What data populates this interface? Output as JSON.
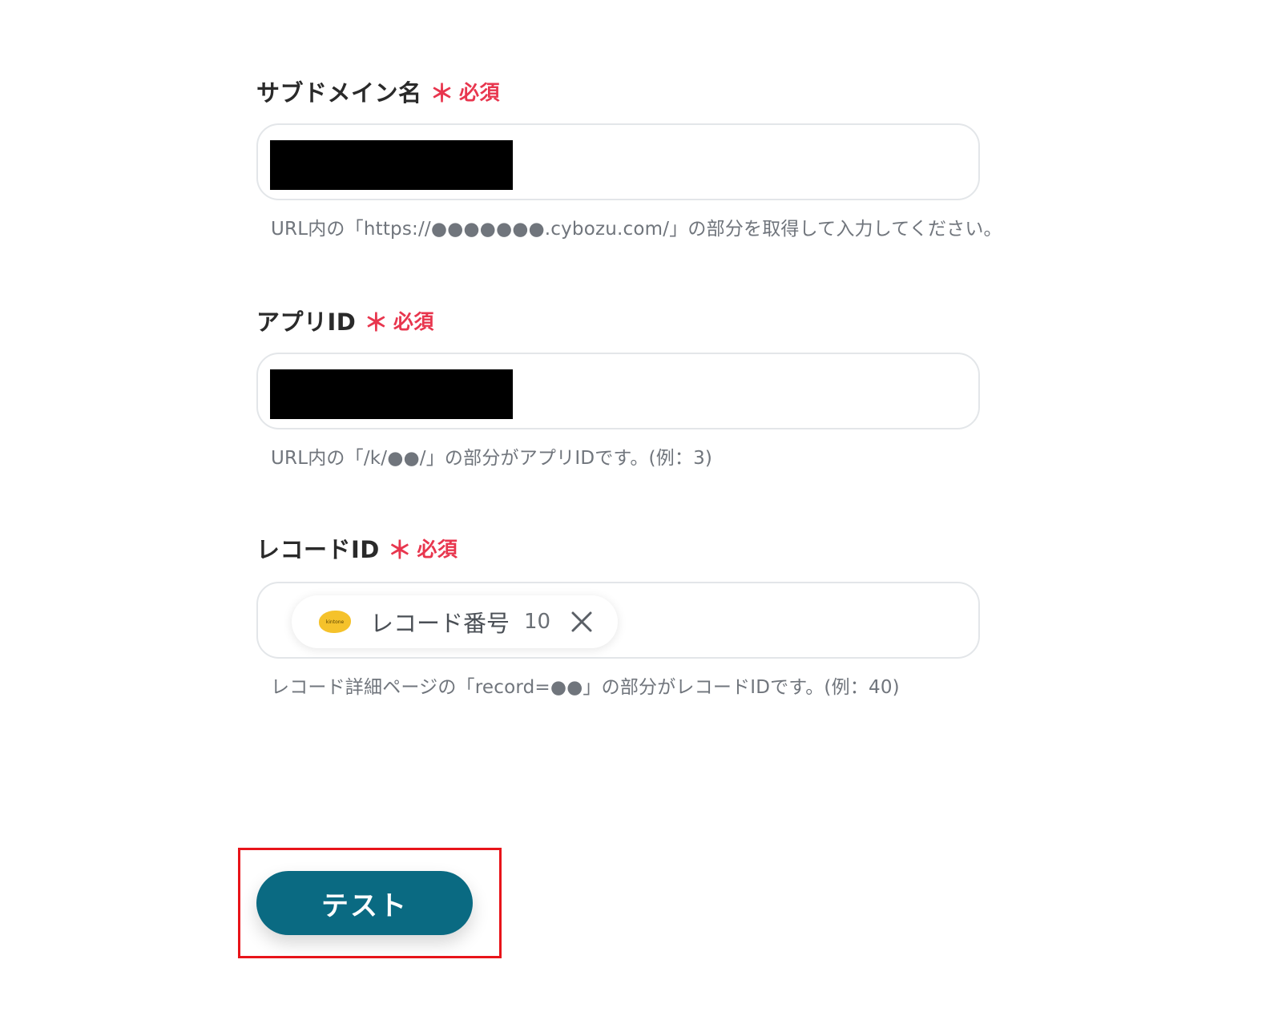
{
  "fields": {
    "subdomain": {
      "label": "サブドメイン名",
      "required_mark": "＊",
      "required_text": "必須",
      "help": "URL内の「https://●●●●●●●.cybozu.com/」の部分を取得して入力してください。"
    },
    "app_id": {
      "label": "アプリID",
      "required_mark": "＊",
      "required_text": "必須",
      "help": "URL内の「/k/●●/」の部分がアプリIDです。(例：3)"
    },
    "record_id": {
      "label": "レコードID",
      "required_mark": "＊",
      "required_text": "必須",
      "chip": {
        "logo_text": "kintone",
        "label": "レコード番号",
        "value": "10",
        "icon": "close-icon"
      },
      "help": "レコード詳細ページの「record=●●」の部分がレコードIDです。(例：40)"
    }
  },
  "actions": {
    "test_label": "テスト"
  },
  "colors": {
    "required": "#e8364e",
    "primary_button": "#0a6a82",
    "highlight_frame": "#e8141a",
    "chip_logo": "#f5c22b"
  }
}
